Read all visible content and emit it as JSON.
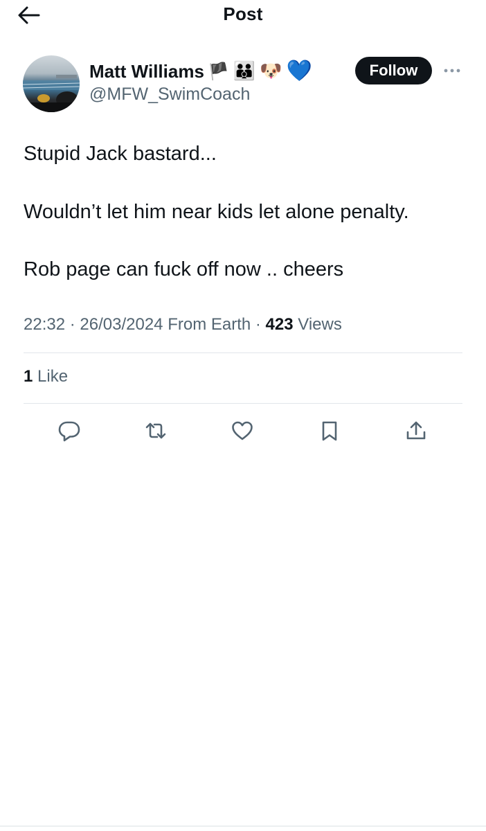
{
  "header": {
    "title": "Post",
    "back_icon": "arrow-left-icon"
  },
  "author": {
    "display_name": "Matt Williams",
    "name_emojis": {
      "wales_flag": "🏴",
      "family": "👪",
      "dog": "🐶",
      "heart": "💙"
    },
    "handle": "@MFW_SwimCoach",
    "follow_label": "Follow",
    "more_icon": "more-horizontal-icon"
  },
  "tweet": {
    "lines": [
      "Stupid Jack bastard...",
      "Wouldn’t let him near kids let alone penalty.",
      "Rob page can fuck off now .. cheers"
    ]
  },
  "meta": {
    "time": "22:32",
    "separator": " · ",
    "date": "26/03/2024",
    "source": "From Earth",
    "views_count": "423",
    "views_label": "Views"
  },
  "engagement": {
    "like_count": "1",
    "like_label": "Like"
  },
  "actions": {
    "reply_icon": "reply-icon",
    "repost_icon": "repost-icon",
    "like_icon": "heart-icon",
    "bookmark_icon": "bookmark-icon",
    "share_icon": "share-icon"
  },
  "colors": {
    "text_primary": "#0f1419",
    "text_secondary": "#536471",
    "follow_bg": "#0f1419",
    "divider": "#e1e6ea"
  }
}
